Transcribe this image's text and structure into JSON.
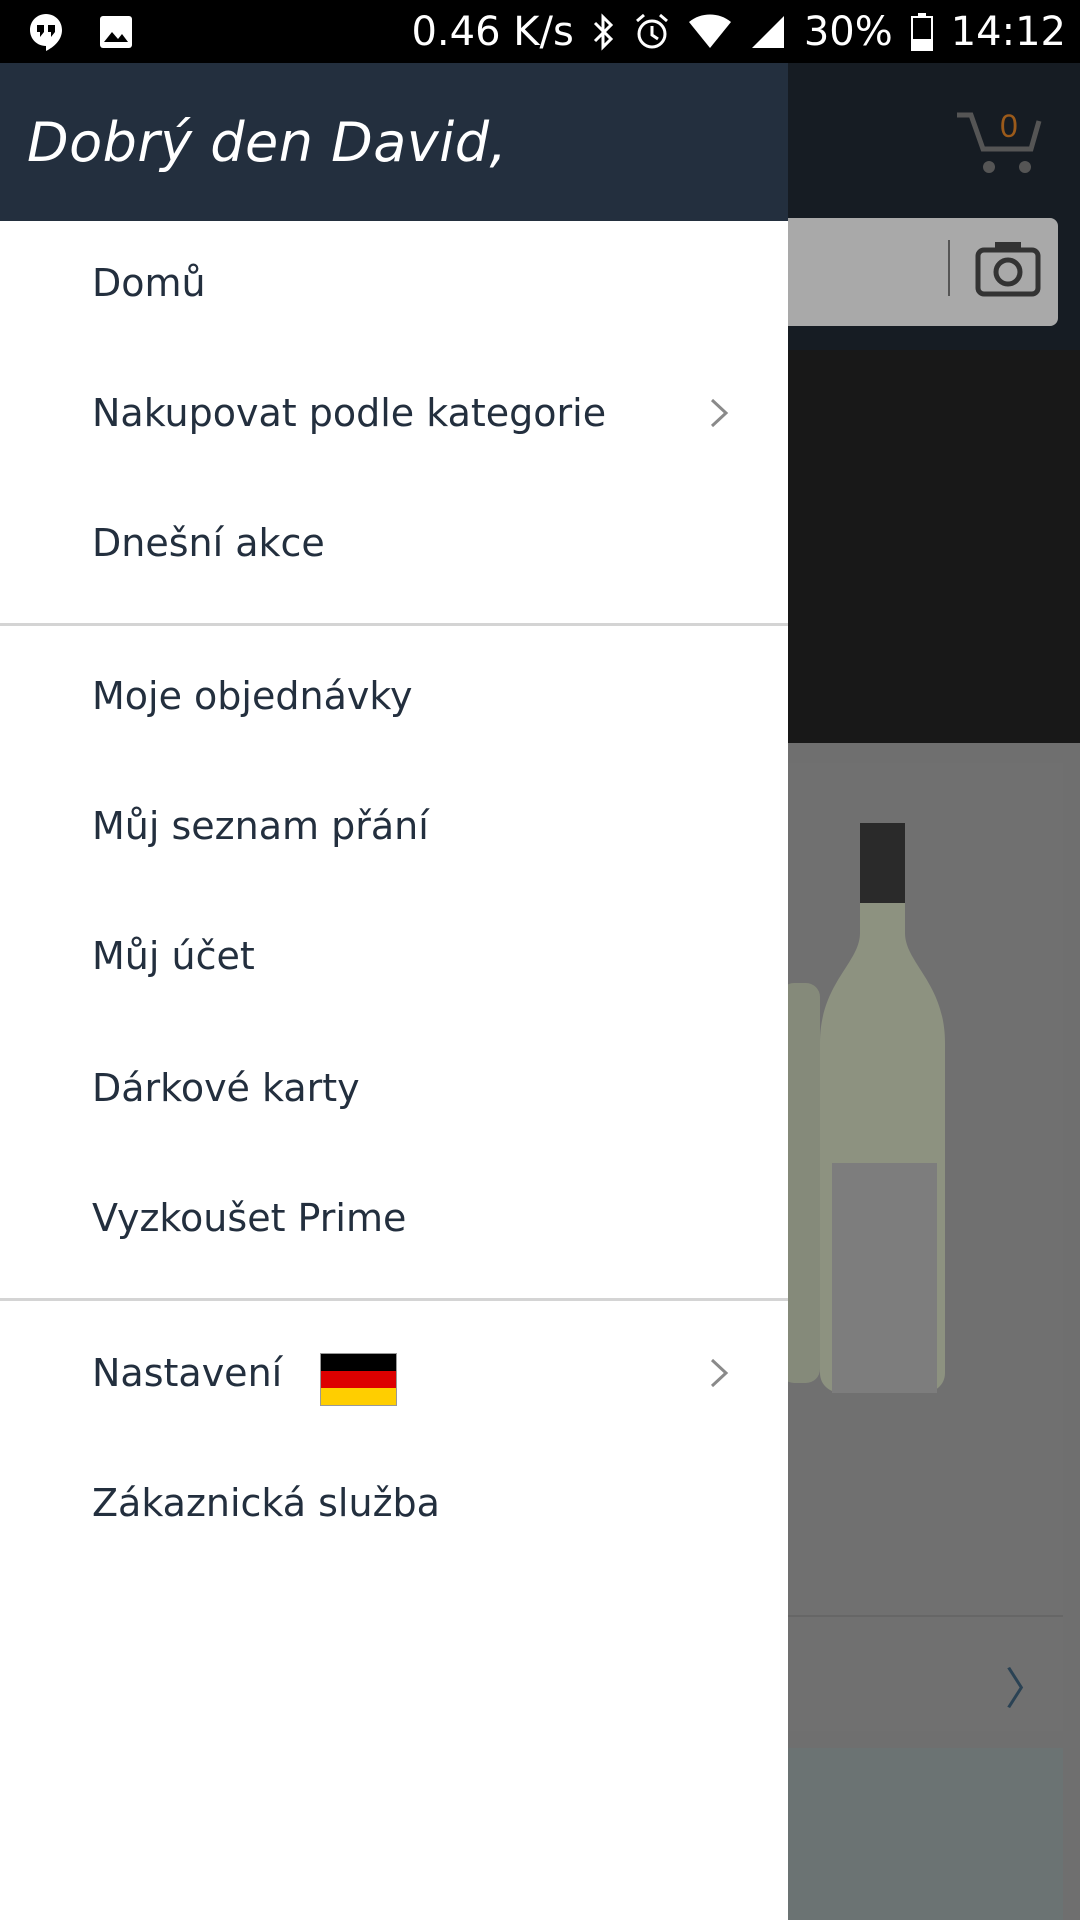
{
  "status_bar": {
    "network_speed": "0.46 K/s",
    "battery": "30%",
    "time": "14:12",
    "icons": [
      "hangouts-icon",
      "image-icon",
      "bluetooth-icon",
      "alarm-icon",
      "wifi-icon",
      "signal-icon",
      "battery-icon"
    ]
  },
  "background_app": {
    "cart_count": "0",
    "icons": [
      "cart-icon",
      "camera-icon",
      "chevron-right-icon"
    ]
  },
  "drawer": {
    "greeting": "Dobrý den David,",
    "items": [
      {
        "label": "Domů"
      },
      {
        "label": "Nakupovat podle kategorie",
        "has_chevron": true
      },
      {
        "label": "Dnešní akce"
      },
      {
        "label": "Moje objednávky"
      },
      {
        "label": "Můj seznam přání"
      },
      {
        "label": "Můj účet"
      },
      {
        "label": "Dárkové karty"
      },
      {
        "label": "Vyzkoušet Prime"
      },
      {
        "label": "Nastavení",
        "has_chevron": true,
        "flag": "germany-flag-icon"
      },
      {
        "label": "Zákaznická služba"
      }
    ],
    "flag_colors": [
      "#000000",
      "#dd0000",
      "#ffce00"
    ],
    "accent_header": "#232f3e"
  }
}
